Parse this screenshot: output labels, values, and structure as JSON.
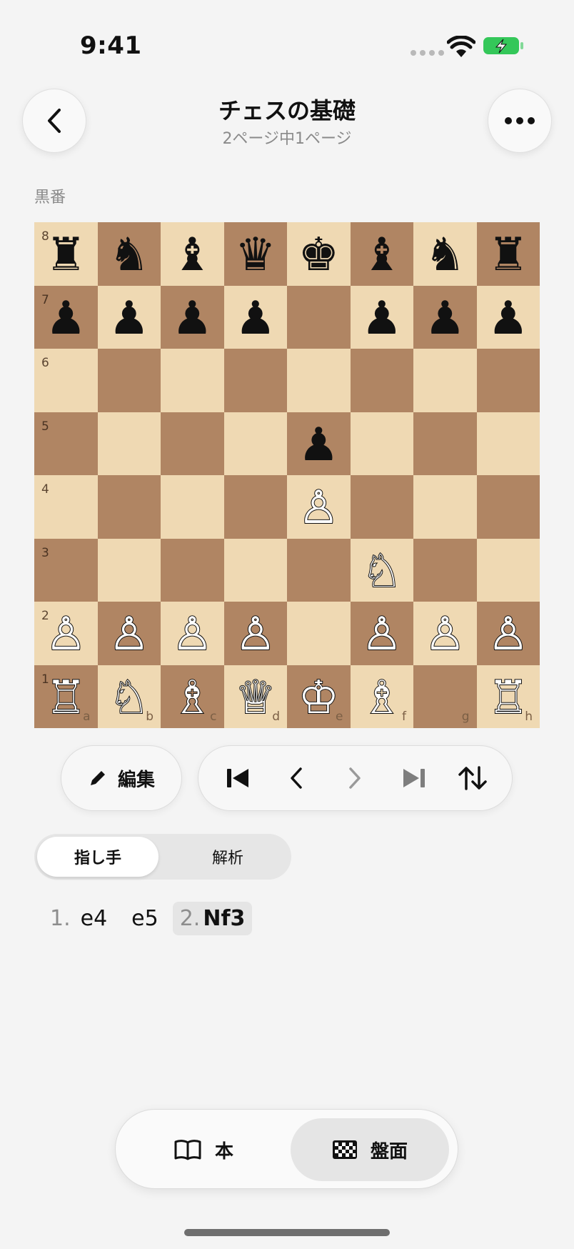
{
  "status_bar": {
    "time": "9:41",
    "battery_color": "#34c759"
  },
  "header": {
    "title": "チェスの基礎",
    "subtitle": "2ページ中1ページ"
  },
  "turn_label": "黒番",
  "board": {
    "ranks": [
      "8",
      "7",
      "6",
      "5",
      "4",
      "3",
      "2",
      "1"
    ],
    "files": [
      "a",
      "b",
      "c",
      "d",
      "e",
      "f",
      "g",
      "h"
    ],
    "light_color": "#efd9b3",
    "dark_color": "#b08563",
    "rows": [
      [
        "♜",
        "♞",
        "♝",
        "♛",
        "♚",
        "♝",
        "♞",
        "♜"
      ],
      [
        "♟",
        "♟",
        "♟",
        "♟",
        "",
        "♟",
        "♟",
        "♟"
      ],
      [
        "",
        "",
        "",
        "",
        "",
        "",
        "",
        ""
      ],
      [
        "",
        "",
        "",
        "",
        "♟",
        "",
        "",
        ""
      ],
      [
        "",
        "",
        "",
        "",
        "♙",
        "",
        "",
        ""
      ],
      [
        "",
        "",
        "",
        "",
        "",
        "♘",
        "",
        ""
      ],
      [
        "♙",
        "♙",
        "♙",
        "♙",
        "",
        "♙",
        "♙",
        "♙"
      ],
      [
        "♖",
        "♘",
        "♗",
        "♕",
        "♔",
        "♗",
        "",
        "♖"
      ]
    ]
  },
  "controls": {
    "edit_label": "編集",
    "nav_buttons": [
      "first-move-icon",
      "prev-move-icon",
      "next-move-icon",
      "last-move-icon",
      "flip-board-icon"
    ]
  },
  "segments": {
    "moves": "指し手",
    "analysis": "解析",
    "selected": "moves"
  },
  "moves": {
    "move1_number": "1.",
    "move1_white": "e4",
    "move1_black": "e5",
    "move2_number": "2.",
    "move2_white": "Nf3"
  },
  "tabs": {
    "book": "本",
    "board": "盤面",
    "selected": "board"
  }
}
